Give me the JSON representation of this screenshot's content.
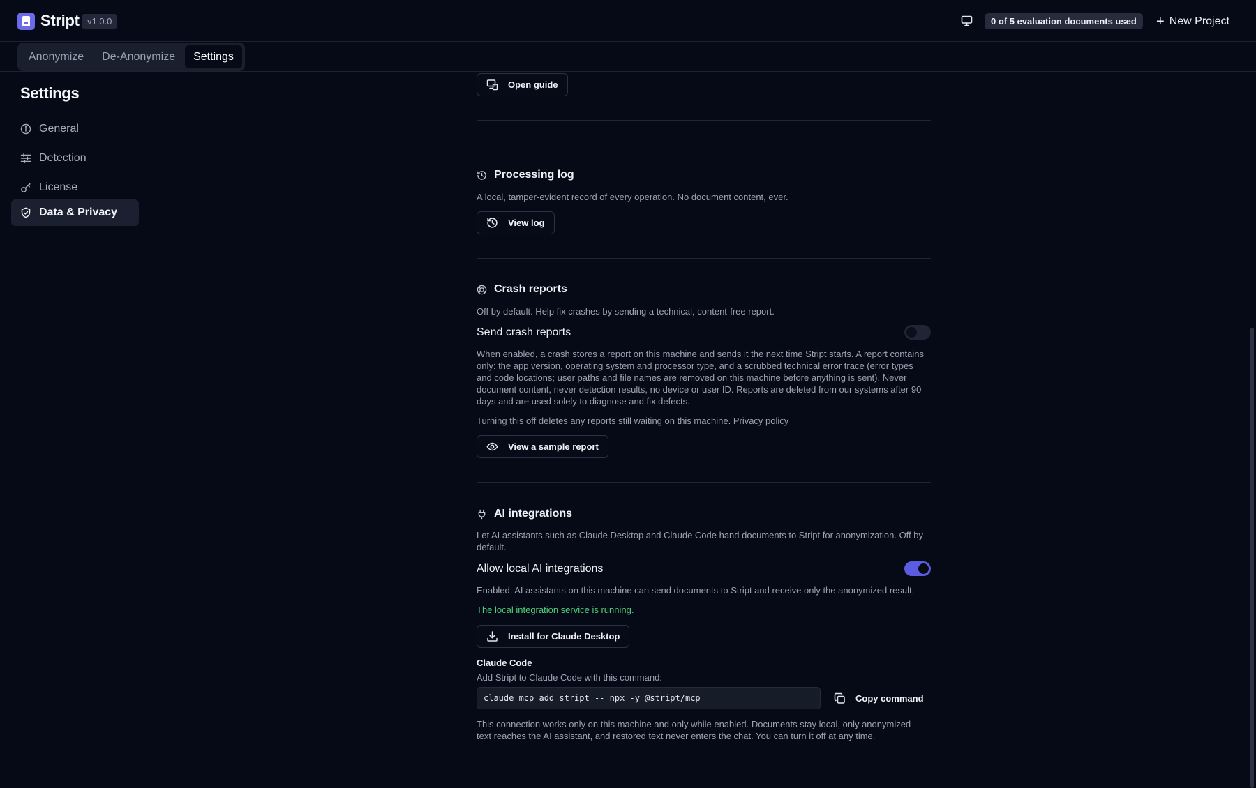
{
  "app": {
    "name": "Stript",
    "version": "v1.0.0",
    "evaluation_badge": "0 of 5 evaluation documents used",
    "new_project_label": "New Project"
  },
  "tabs": [
    {
      "label": "Anonymize",
      "active": false
    },
    {
      "label": "De-Anonymize",
      "active": false
    },
    {
      "label": "Settings",
      "active": true
    }
  ],
  "sidebar": {
    "title": "Settings",
    "items": [
      {
        "label": "General",
        "icon": "info-icon",
        "active": false
      },
      {
        "label": "Detection",
        "icon": "sliders-icon",
        "active": false
      },
      {
        "label": "License",
        "icon": "key-icon",
        "active": false
      },
      {
        "label": "Data & Privacy",
        "icon": "shield-icon",
        "active": true
      }
    ]
  },
  "guide": {
    "button_label": "Open guide"
  },
  "processing_log": {
    "title": "Processing log",
    "description": "A local, tamper-evident record of every operation. No document content, ever.",
    "button_label": "View log"
  },
  "crash_reports": {
    "title": "Crash reports",
    "description": "Off by default. Help fix crashes by sending a technical, content-free report.",
    "toggle_label": "Send crash reports",
    "toggle_on": false,
    "details": "When enabled, a crash stores a report on this machine and sends it the next time Stript starts. A report contains only: the app version, operating system and processor type, and a scrubbed technical error trace (error types and code locations; user paths and file names are removed on this machine before anything is sent). Never document content, never detection results, no device or user ID. Reports are deleted from our systems after 90 days and are used solely to diagnose and fix defects.",
    "turning_off_note": "Turning this off deletes any reports still waiting on this machine.",
    "privacy_link": "Privacy policy",
    "button_label": "View a sample report"
  },
  "ai_integrations": {
    "title": "AI integrations",
    "description": "Let AI assistants such as Claude Desktop and Claude Code hand documents to Stript for anonymization. Off by default.",
    "toggle_label": "Allow local AI integrations",
    "toggle_on": true,
    "enabled_note": "Enabled. AI assistants on this machine can send documents to Stript and receive only the anonymized result.",
    "status": "The local integration service is running.",
    "install_button_label": "Install for Claude Desktop",
    "claude_code_label": "Claude Code",
    "claude_code_hint": "Add Stript to Claude Code with this command:",
    "command": "claude mcp add stript -- npx -y @stript/mcp",
    "copy_label": "Copy command",
    "footer": "This connection works only on this machine and only while enabled. Documents stay local, only anonymized text reaches the AI assistant, and restored text never enters the chat. You can turn it off at any time."
  },
  "colors": {
    "background": "#060a16",
    "accent": "#5c5ce0",
    "success": "#4fd07a"
  }
}
